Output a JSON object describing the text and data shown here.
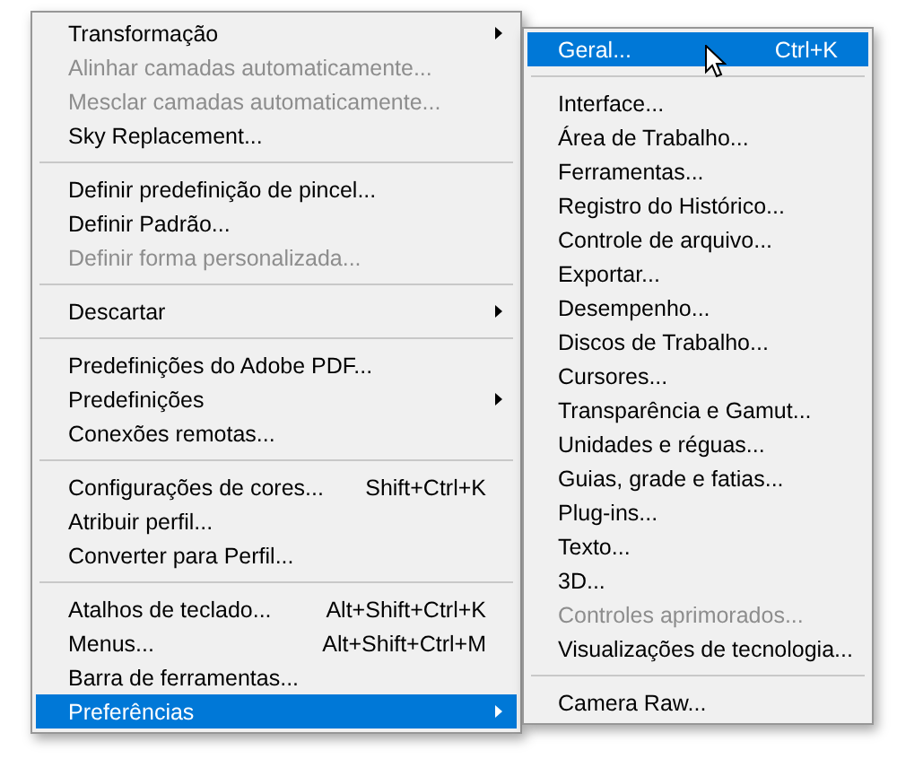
{
  "main_menu": {
    "items": [
      {
        "kind": "item",
        "label": "Transformação",
        "submenu": true,
        "disabled": false,
        "selected": false
      },
      {
        "kind": "item",
        "label": "Alinhar camadas automaticamente...",
        "submenu": false,
        "disabled": true,
        "selected": false
      },
      {
        "kind": "item",
        "label": "Mesclar camadas automaticamente...",
        "submenu": false,
        "disabled": true,
        "selected": false
      },
      {
        "kind": "item",
        "label": "Sky Replacement...",
        "submenu": false,
        "disabled": false,
        "selected": false
      },
      {
        "kind": "separator"
      },
      {
        "kind": "item",
        "label": "Definir predefinição de pincel...",
        "submenu": false,
        "disabled": false,
        "selected": false
      },
      {
        "kind": "item",
        "label": "Definir Padrão...",
        "submenu": false,
        "disabled": false,
        "selected": false
      },
      {
        "kind": "item",
        "label": "Definir forma personalizada...",
        "submenu": false,
        "disabled": true,
        "selected": false
      },
      {
        "kind": "separator"
      },
      {
        "kind": "item",
        "label": "Descartar",
        "submenu": true,
        "disabled": false,
        "selected": false
      },
      {
        "kind": "separator"
      },
      {
        "kind": "item",
        "label": "Predefinições do Adobe PDF...",
        "submenu": false,
        "disabled": false,
        "selected": false
      },
      {
        "kind": "item",
        "label": "Predefinições",
        "submenu": true,
        "disabled": false,
        "selected": false
      },
      {
        "kind": "item",
        "label": "Conexões remotas...",
        "submenu": false,
        "disabled": false,
        "selected": false
      },
      {
        "kind": "separator"
      },
      {
        "kind": "item",
        "label": "Configurações de cores...",
        "shortcut": "Shift+Ctrl+K",
        "submenu": false,
        "disabled": false,
        "selected": false
      },
      {
        "kind": "item",
        "label": "Atribuir perfil...",
        "submenu": false,
        "disabled": false,
        "selected": false
      },
      {
        "kind": "item",
        "label": "Converter para Perfil...",
        "submenu": false,
        "disabled": false,
        "selected": false
      },
      {
        "kind": "separator"
      },
      {
        "kind": "item",
        "label": "Atalhos de teclado...",
        "shortcut": "Alt+Shift+Ctrl+K",
        "submenu": false,
        "disabled": false,
        "selected": false
      },
      {
        "kind": "item",
        "label": "Menus...",
        "shortcut": "Alt+Shift+Ctrl+M",
        "submenu": false,
        "disabled": false,
        "selected": false
      },
      {
        "kind": "item",
        "label": "Barra de ferramentas...",
        "submenu": false,
        "disabled": false,
        "selected": false
      },
      {
        "kind": "item",
        "label": "Preferências",
        "submenu": true,
        "disabled": false,
        "selected": true
      }
    ]
  },
  "submenu": {
    "items": [
      {
        "kind": "item",
        "label": "Geral...",
        "shortcut": "Ctrl+K",
        "submenu": false,
        "disabled": false,
        "selected": true
      },
      {
        "kind": "separator"
      },
      {
        "kind": "item",
        "label": "Interface...",
        "submenu": false,
        "disabled": false,
        "selected": false
      },
      {
        "kind": "item",
        "label": "Área de Trabalho...",
        "submenu": false,
        "disabled": false,
        "selected": false
      },
      {
        "kind": "item",
        "label": "Ferramentas...",
        "submenu": false,
        "disabled": false,
        "selected": false
      },
      {
        "kind": "item",
        "label": "Registro do Histórico...",
        "submenu": false,
        "disabled": false,
        "selected": false
      },
      {
        "kind": "item",
        "label": "Controle de arquivo...",
        "submenu": false,
        "disabled": false,
        "selected": false
      },
      {
        "kind": "item",
        "label": "Exportar...",
        "submenu": false,
        "disabled": false,
        "selected": false
      },
      {
        "kind": "item",
        "label": "Desempenho...",
        "submenu": false,
        "disabled": false,
        "selected": false
      },
      {
        "kind": "item",
        "label": "Discos de Trabalho...",
        "submenu": false,
        "disabled": false,
        "selected": false
      },
      {
        "kind": "item",
        "label": "Cursores...",
        "submenu": false,
        "disabled": false,
        "selected": false
      },
      {
        "kind": "item",
        "label": "Transparência e Gamut...",
        "submenu": false,
        "disabled": false,
        "selected": false
      },
      {
        "kind": "item",
        "label": "Unidades e réguas...",
        "submenu": false,
        "disabled": false,
        "selected": false
      },
      {
        "kind": "item",
        "label": "Guias, grade e fatias...",
        "submenu": false,
        "disabled": false,
        "selected": false
      },
      {
        "kind": "item",
        "label": "Plug-ins...",
        "submenu": false,
        "disabled": false,
        "selected": false
      },
      {
        "kind": "item",
        "label": "Texto...",
        "submenu": false,
        "disabled": false,
        "selected": false
      },
      {
        "kind": "item",
        "label": "3D...",
        "submenu": false,
        "disabled": false,
        "selected": false
      },
      {
        "kind": "item",
        "label": "Controles aprimorados...",
        "submenu": false,
        "disabled": true,
        "selected": false
      },
      {
        "kind": "item",
        "label": "Visualizações de tecnologia...",
        "submenu": false,
        "disabled": false,
        "selected": false
      },
      {
        "kind": "separator"
      },
      {
        "kind": "item",
        "label": "Camera Raw...",
        "submenu": false,
        "disabled": false,
        "selected": false
      }
    ]
  }
}
